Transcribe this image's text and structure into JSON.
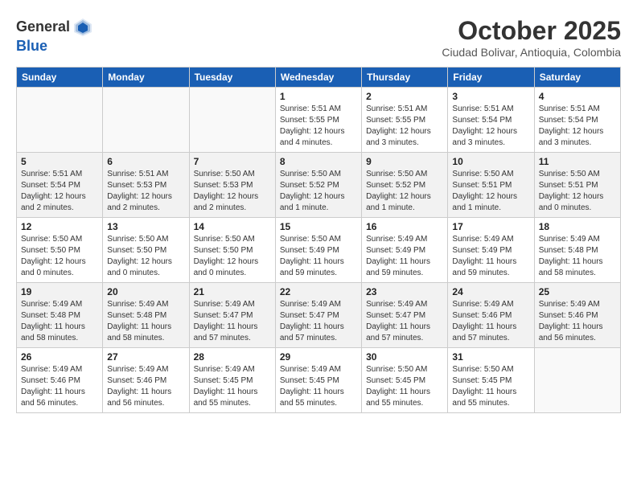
{
  "header": {
    "logo_general": "General",
    "logo_blue": "Blue",
    "month_title": "October 2025",
    "subtitle": "Ciudad Bolivar, Antioquia, Colombia"
  },
  "days_of_week": [
    "Sunday",
    "Monday",
    "Tuesday",
    "Wednesday",
    "Thursday",
    "Friday",
    "Saturday"
  ],
  "weeks": [
    [
      {
        "day": "",
        "info": ""
      },
      {
        "day": "",
        "info": ""
      },
      {
        "day": "",
        "info": ""
      },
      {
        "day": "1",
        "info": "Sunrise: 5:51 AM\nSunset: 5:55 PM\nDaylight: 12 hours\nand 4 minutes."
      },
      {
        "day": "2",
        "info": "Sunrise: 5:51 AM\nSunset: 5:55 PM\nDaylight: 12 hours\nand 3 minutes."
      },
      {
        "day": "3",
        "info": "Sunrise: 5:51 AM\nSunset: 5:54 PM\nDaylight: 12 hours\nand 3 minutes."
      },
      {
        "day": "4",
        "info": "Sunrise: 5:51 AM\nSunset: 5:54 PM\nDaylight: 12 hours\nand 3 minutes."
      }
    ],
    [
      {
        "day": "5",
        "info": "Sunrise: 5:51 AM\nSunset: 5:54 PM\nDaylight: 12 hours\nand 2 minutes."
      },
      {
        "day": "6",
        "info": "Sunrise: 5:51 AM\nSunset: 5:53 PM\nDaylight: 12 hours\nand 2 minutes."
      },
      {
        "day": "7",
        "info": "Sunrise: 5:50 AM\nSunset: 5:53 PM\nDaylight: 12 hours\nand 2 minutes."
      },
      {
        "day": "8",
        "info": "Sunrise: 5:50 AM\nSunset: 5:52 PM\nDaylight: 12 hours\nand 1 minute."
      },
      {
        "day": "9",
        "info": "Sunrise: 5:50 AM\nSunset: 5:52 PM\nDaylight: 12 hours\nand 1 minute."
      },
      {
        "day": "10",
        "info": "Sunrise: 5:50 AM\nSunset: 5:51 PM\nDaylight: 12 hours\nand 1 minute."
      },
      {
        "day": "11",
        "info": "Sunrise: 5:50 AM\nSunset: 5:51 PM\nDaylight: 12 hours\nand 0 minutes."
      }
    ],
    [
      {
        "day": "12",
        "info": "Sunrise: 5:50 AM\nSunset: 5:50 PM\nDaylight: 12 hours\nand 0 minutes."
      },
      {
        "day": "13",
        "info": "Sunrise: 5:50 AM\nSunset: 5:50 PM\nDaylight: 12 hours\nand 0 minutes."
      },
      {
        "day": "14",
        "info": "Sunrise: 5:50 AM\nSunset: 5:50 PM\nDaylight: 12 hours\nand 0 minutes."
      },
      {
        "day": "15",
        "info": "Sunrise: 5:50 AM\nSunset: 5:49 PM\nDaylight: 11 hours\nand 59 minutes."
      },
      {
        "day": "16",
        "info": "Sunrise: 5:49 AM\nSunset: 5:49 PM\nDaylight: 11 hours\nand 59 minutes."
      },
      {
        "day": "17",
        "info": "Sunrise: 5:49 AM\nSunset: 5:49 PM\nDaylight: 11 hours\nand 59 minutes."
      },
      {
        "day": "18",
        "info": "Sunrise: 5:49 AM\nSunset: 5:48 PM\nDaylight: 11 hours\nand 58 minutes."
      }
    ],
    [
      {
        "day": "19",
        "info": "Sunrise: 5:49 AM\nSunset: 5:48 PM\nDaylight: 11 hours\nand 58 minutes."
      },
      {
        "day": "20",
        "info": "Sunrise: 5:49 AM\nSunset: 5:48 PM\nDaylight: 11 hours\nand 58 minutes."
      },
      {
        "day": "21",
        "info": "Sunrise: 5:49 AM\nSunset: 5:47 PM\nDaylight: 11 hours\nand 57 minutes."
      },
      {
        "day": "22",
        "info": "Sunrise: 5:49 AM\nSunset: 5:47 PM\nDaylight: 11 hours\nand 57 minutes."
      },
      {
        "day": "23",
        "info": "Sunrise: 5:49 AM\nSunset: 5:47 PM\nDaylight: 11 hours\nand 57 minutes."
      },
      {
        "day": "24",
        "info": "Sunrise: 5:49 AM\nSunset: 5:46 PM\nDaylight: 11 hours\nand 57 minutes."
      },
      {
        "day": "25",
        "info": "Sunrise: 5:49 AM\nSunset: 5:46 PM\nDaylight: 11 hours\nand 56 minutes."
      }
    ],
    [
      {
        "day": "26",
        "info": "Sunrise: 5:49 AM\nSunset: 5:46 PM\nDaylight: 11 hours\nand 56 minutes."
      },
      {
        "day": "27",
        "info": "Sunrise: 5:49 AM\nSunset: 5:46 PM\nDaylight: 11 hours\nand 56 minutes."
      },
      {
        "day": "28",
        "info": "Sunrise: 5:49 AM\nSunset: 5:45 PM\nDaylight: 11 hours\nand 55 minutes."
      },
      {
        "day": "29",
        "info": "Sunrise: 5:49 AM\nSunset: 5:45 PM\nDaylight: 11 hours\nand 55 minutes."
      },
      {
        "day": "30",
        "info": "Sunrise: 5:50 AM\nSunset: 5:45 PM\nDaylight: 11 hours\nand 55 minutes."
      },
      {
        "day": "31",
        "info": "Sunrise: 5:50 AM\nSunset: 5:45 PM\nDaylight: 11 hours\nand 55 minutes."
      },
      {
        "day": "",
        "info": ""
      }
    ]
  ]
}
